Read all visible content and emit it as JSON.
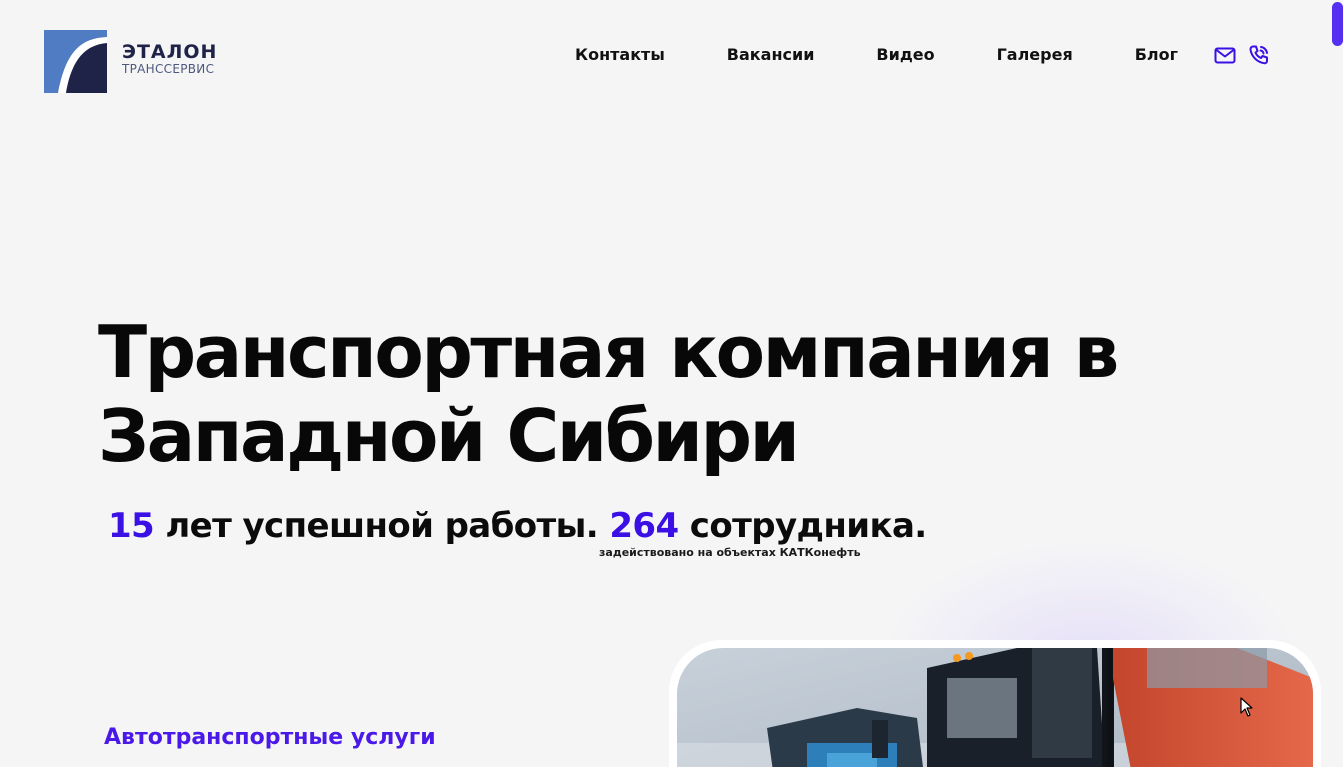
{
  "header": {
    "logo": {
      "title": "ЭТАЛОН",
      "subtitle": "ТРАНССЕРВИС"
    },
    "nav": [
      {
        "label": "Контакты"
      },
      {
        "label": "Вакансии"
      },
      {
        "label": "Видео"
      },
      {
        "label": "Галерея"
      },
      {
        "label": "Блог"
      }
    ],
    "icons": [
      "mail-icon",
      "phone-call-icon"
    ]
  },
  "hero": {
    "title_line1": "Транспортная компания в",
    "title_line2": "Западной Сибири",
    "years_value": "15",
    "years_text": "лет успешной работы.",
    "employees_value": "264",
    "employees_text": "сотрудника.",
    "employees_note": "задействовано на объектах КАТКонефть"
  },
  "services": {
    "title": "Автотранспортные услуги"
  },
  "colors": {
    "accent": "#3a10e5",
    "brand_dark": "#1e2347",
    "brand_blue": "#4f7cc2",
    "background": "#f5f5f6"
  }
}
